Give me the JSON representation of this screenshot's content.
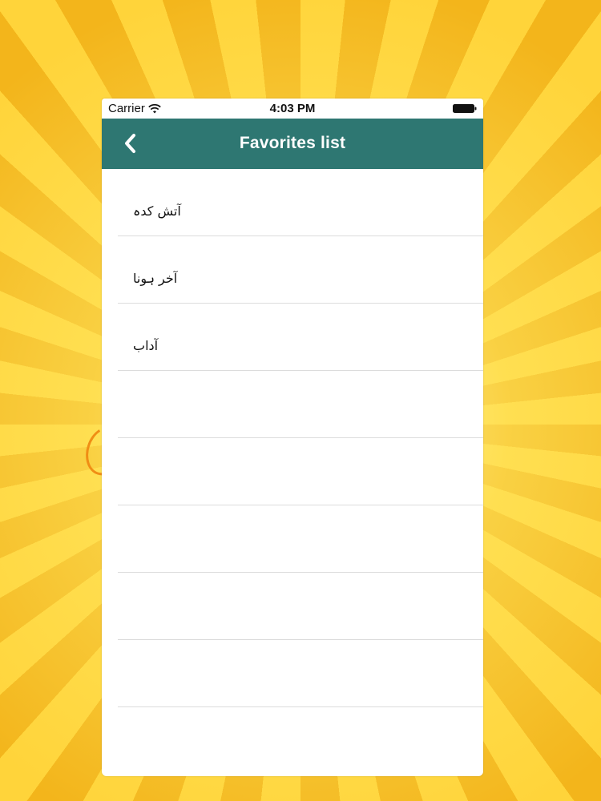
{
  "status_bar": {
    "carrier": "Carrier",
    "time": "4:03 PM",
    "icons": [
      "wifi-icon",
      "battery-icon"
    ]
  },
  "nav_bar": {
    "title": "Favorites list",
    "back_icon": "chevron-left-icon",
    "color": "#2e7772"
  },
  "favorites": [
    {
      "label": "آتش کدہ"
    },
    {
      "label": "آخر ہونا"
    },
    {
      "label": "آداب"
    },
    {
      "label": ""
    },
    {
      "label": ""
    },
    {
      "label": ""
    },
    {
      "label": ""
    },
    {
      "label": ""
    }
  ],
  "background": {
    "style": "sunburst",
    "primary_color": "#f6c21d"
  }
}
